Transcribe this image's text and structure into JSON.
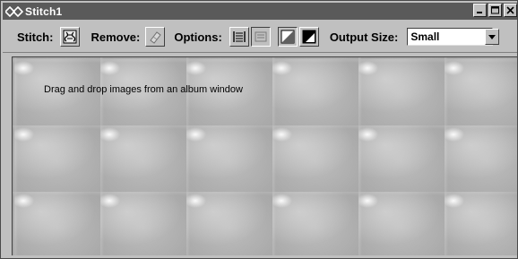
{
  "window": {
    "title": "Stitch1"
  },
  "toolbar": {
    "stitch_label": "Stitch:",
    "remove_label": "Remove:",
    "options_label": "Options:",
    "output_size_label": "Output Size:",
    "output_size_value": "Small"
  },
  "canvas": {
    "hint": "Drag and drop images from an album window"
  },
  "icons": {
    "app": "link-diamonds-icon",
    "stitch": "stitch-icon",
    "remove": "eraser-icon",
    "option1": "align-horizontal-icon",
    "option2": "align-vertical-icon",
    "option3": "light-background-icon",
    "option4": "dark-background-icon"
  },
  "colors": {
    "titlebar": "#5a5a5a",
    "face": "#c0c0c0",
    "canvas": "#bdbdbd"
  }
}
